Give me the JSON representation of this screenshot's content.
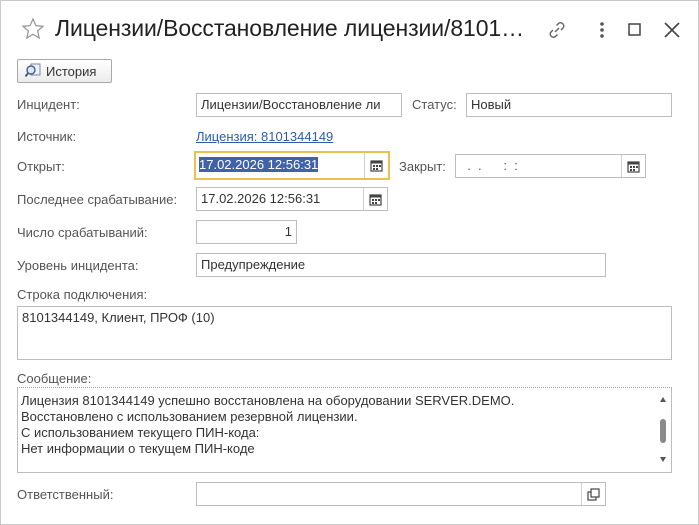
{
  "window": {
    "title": "Лицензии/Восстановление лицензии/8101…",
    "icons": [
      "star-icon",
      "link-icon",
      "more-icon",
      "maximize-icon",
      "close-icon"
    ]
  },
  "toolbar": {
    "history_label": "История"
  },
  "form": {
    "incident_label": "Инцидент:",
    "incident_value": "Лицензии/Восстановление ли",
    "status_label": "Статус:",
    "status_value": "Новый",
    "source_label": "Источник:",
    "source_link": "Лицензия: 8101344149",
    "opened_label": "Открыт:",
    "opened_value": "17.02.2026 12:56:31",
    "closed_label": "Закрыт:",
    "closed_value": "  .  .      :  :",
    "last_trigger_label": "Последнее срабатывание:",
    "last_trigger_value": "17.02.2026 12:56:31",
    "trigger_count_label": "Число срабатываний:",
    "trigger_count_value": "1",
    "level_label": "Уровень инцидента:",
    "level_value": "Предупреждение",
    "connection_label": "Строка подключения:",
    "connection_value": "8101344149, Клиент, ПРОФ (10)",
    "message_label": "Сообщение:",
    "message_lines": [
      "Лицензия 8101344149 успешно восстановлена на оборудовании SERVER.DEMO.",
      "Восстановлено с использованием резервной лицензии.",
      "С использованием текущего ПИН-кода:",
      "Нет информации о текущем ПИН-коде"
    ],
    "responsible_label": "Ответственный:",
    "responsible_value": ""
  },
  "colors": {
    "accent": "#e9c153",
    "selection": "#3f62a8",
    "link": "#2d5ea5"
  }
}
